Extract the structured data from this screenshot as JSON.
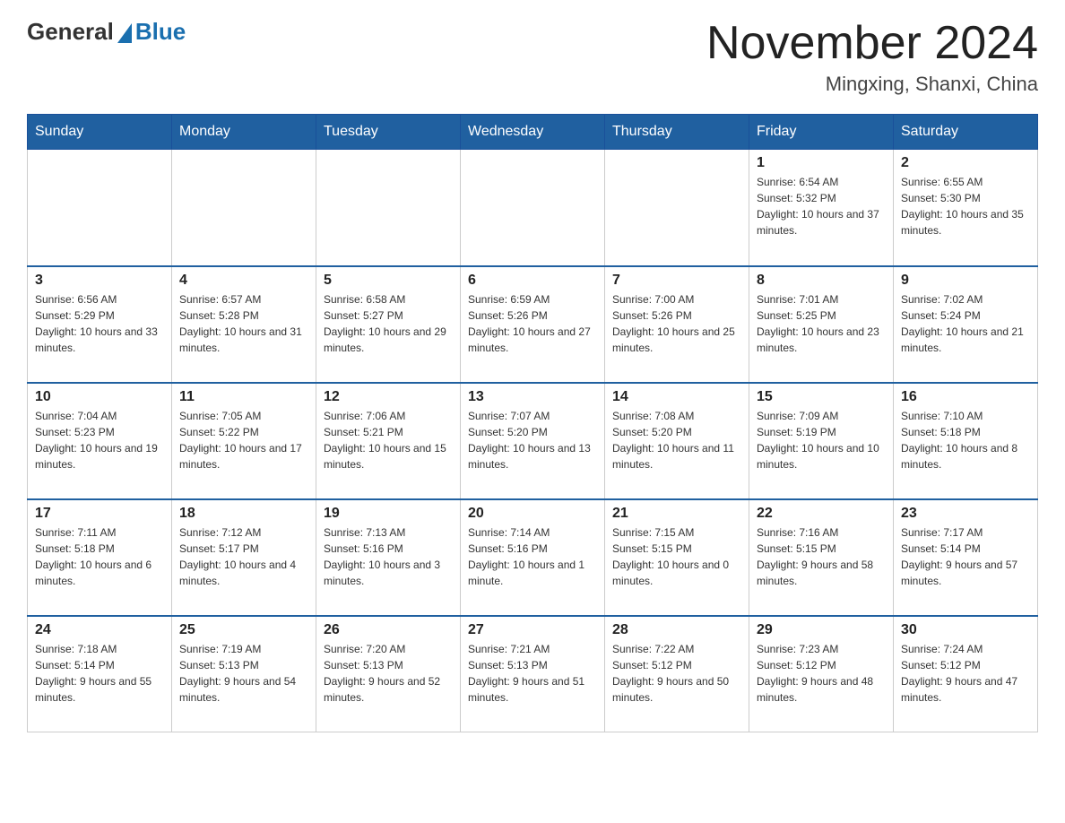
{
  "header": {
    "logo_general": "General",
    "logo_blue": "Blue",
    "month_title": "November 2024",
    "location": "Mingxing, Shanxi, China"
  },
  "days_of_week": [
    "Sunday",
    "Monday",
    "Tuesday",
    "Wednesday",
    "Thursday",
    "Friday",
    "Saturday"
  ],
  "weeks": [
    [
      {
        "day": "",
        "info": ""
      },
      {
        "day": "",
        "info": ""
      },
      {
        "day": "",
        "info": ""
      },
      {
        "day": "",
        "info": ""
      },
      {
        "day": "",
        "info": ""
      },
      {
        "day": "1",
        "info": "Sunrise: 6:54 AM\nSunset: 5:32 PM\nDaylight: 10 hours and 37 minutes."
      },
      {
        "day": "2",
        "info": "Sunrise: 6:55 AM\nSunset: 5:30 PM\nDaylight: 10 hours and 35 minutes."
      }
    ],
    [
      {
        "day": "3",
        "info": "Sunrise: 6:56 AM\nSunset: 5:29 PM\nDaylight: 10 hours and 33 minutes."
      },
      {
        "day": "4",
        "info": "Sunrise: 6:57 AM\nSunset: 5:28 PM\nDaylight: 10 hours and 31 minutes."
      },
      {
        "day": "5",
        "info": "Sunrise: 6:58 AM\nSunset: 5:27 PM\nDaylight: 10 hours and 29 minutes."
      },
      {
        "day": "6",
        "info": "Sunrise: 6:59 AM\nSunset: 5:26 PM\nDaylight: 10 hours and 27 minutes."
      },
      {
        "day": "7",
        "info": "Sunrise: 7:00 AM\nSunset: 5:26 PM\nDaylight: 10 hours and 25 minutes."
      },
      {
        "day": "8",
        "info": "Sunrise: 7:01 AM\nSunset: 5:25 PM\nDaylight: 10 hours and 23 minutes."
      },
      {
        "day": "9",
        "info": "Sunrise: 7:02 AM\nSunset: 5:24 PM\nDaylight: 10 hours and 21 minutes."
      }
    ],
    [
      {
        "day": "10",
        "info": "Sunrise: 7:04 AM\nSunset: 5:23 PM\nDaylight: 10 hours and 19 minutes."
      },
      {
        "day": "11",
        "info": "Sunrise: 7:05 AM\nSunset: 5:22 PM\nDaylight: 10 hours and 17 minutes."
      },
      {
        "day": "12",
        "info": "Sunrise: 7:06 AM\nSunset: 5:21 PM\nDaylight: 10 hours and 15 minutes."
      },
      {
        "day": "13",
        "info": "Sunrise: 7:07 AM\nSunset: 5:20 PM\nDaylight: 10 hours and 13 minutes."
      },
      {
        "day": "14",
        "info": "Sunrise: 7:08 AM\nSunset: 5:20 PM\nDaylight: 10 hours and 11 minutes."
      },
      {
        "day": "15",
        "info": "Sunrise: 7:09 AM\nSunset: 5:19 PM\nDaylight: 10 hours and 10 minutes."
      },
      {
        "day": "16",
        "info": "Sunrise: 7:10 AM\nSunset: 5:18 PM\nDaylight: 10 hours and 8 minutes."
      }
    ],
    [
      {
        "day": "17",
        "info": "Sunrise: 7:11 AM\nSunset: 5:18 PM\nDaylight: 10 hours and 6 minutes."
      },
      {
        "day": "18",
        "info": "Sunrise: 7:12 AM\nSunset: 5:17 PM\nDaylight: 10 hours and 4 minutes."
      },
      {
        "day": "19",
        "info": "Sunrise: 7:13 AM\nSunset: 5:16 PM\nDaylight: 10 hours and 3 minutes."
      },
      {
        "day": "20",
        "info": "Sunrise: 7:14 AM\nSunset: 5:16 PM\nDaylight: 10 hours and 1 minute."
      },
      {
        "day": "21",
        "info": "Sunrise: 7:15 AM\nSunset: 5:15 PM\nDaylight: 10 hours and 0 minutes."
      },
      {
        "day": "22",
        "info": "Sunrise: 7:16 AM\nSunset: 5:15 PM\nDaylight: 9 hours and 58 minutes."
      },
      {
        "day": "23",
        "info": "Sunrise: 7:17 AM\nSunset: 5:14 PM\nDaylight: 9 hours and 57 minutes."
      }
    ],
    [
      {
        "day": "24",
        "info": "Sunrise: 7:18 AM\nSunset: 5:14 PM\nDaylight: 9 hours and 55 minutes."
      },
      {
        "day": "25",
        "info": "Sunrise: 7:19 AM\nSunset: 5:13 PM\nDaylight: 9 hours and 54 minutes."
      },
      {
        "day": "26",
        "info": "Sunrise: 7:20 AM\nSunset: 5:13 PM\nDaylight: 9 hours and 52 minutes."
      },
      {
        "day": "27",
        "info": "Sunrise: 7:21 AM\nSunset: 5:13 PM\nDaylight: 9 hours and 51 minutes."
      },
      {
        "day": "28",
        "info": "Sunrise: 7:22 AM\nSunset: 5:12 PM\nDaylight: 9 hours and 50 minutes."
      },
      {
        "day": "29",
        "info": "Sunrise: 7:23 AM\nSunset: 5:12 PM\nDaylight: 9 hours and 48 minutes."
      },
      {
        "day": "30",
        "info": "Sunrise: 7:24 AM\nSunset: 5:12 PM\nDaylight: 9 hours and 47 minutes."
      }
    ]
  ]
}
